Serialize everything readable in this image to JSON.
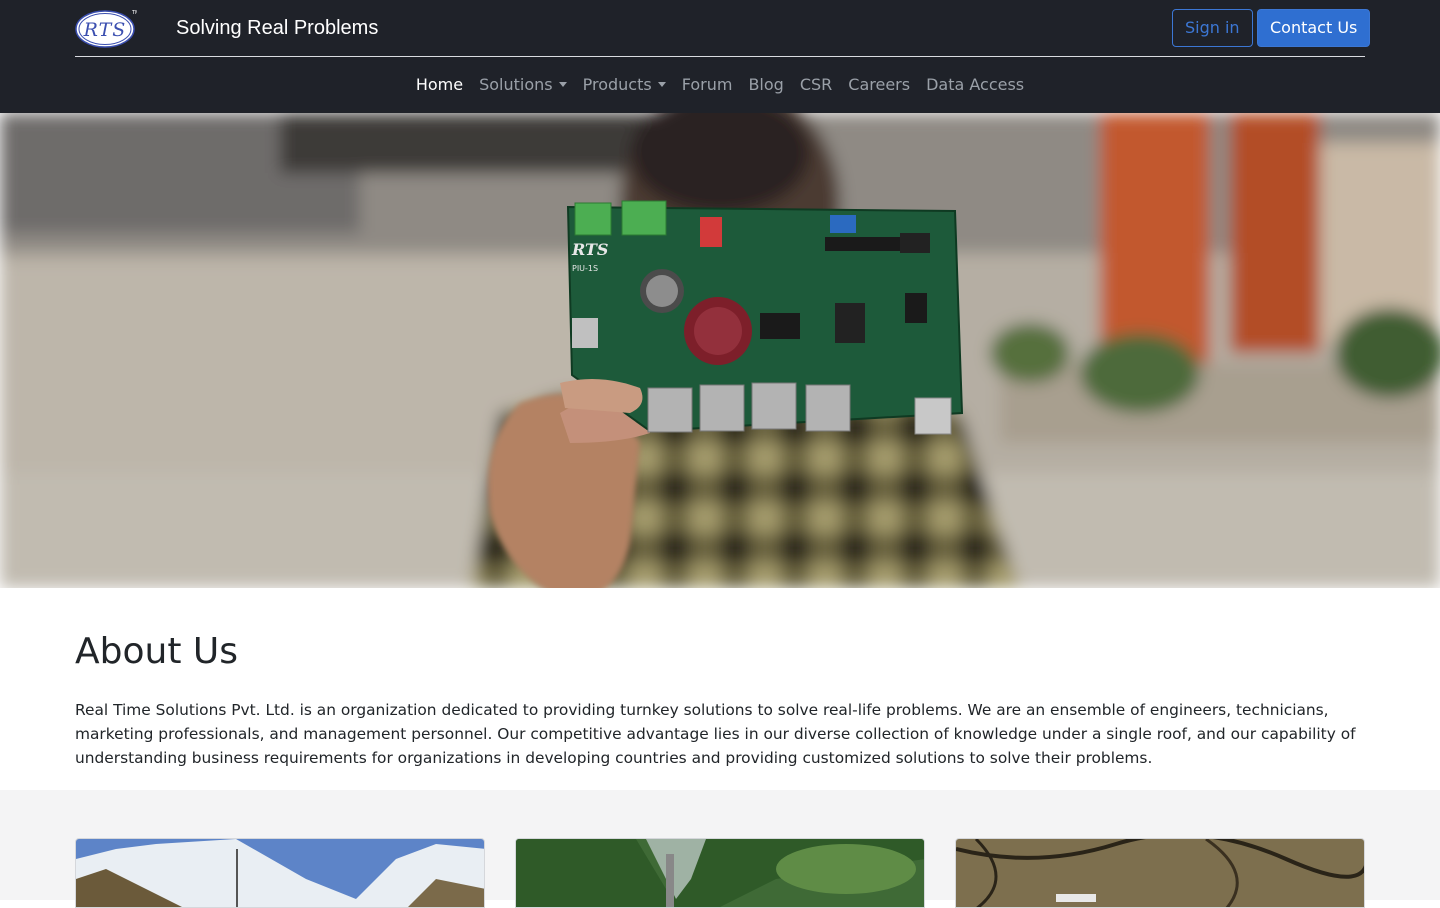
{
  "header": {
    "brand_text": "Solving Real Problems",
    "logo_text": "RTS",
    "logo_tm": "TM",
    "signin_label": "Sign in",
    "contact_label": "Contact Us"
  },
  "nav": {
    "items": [
      {
        "label": "Home",
        "active": true
      },
      {
        "label": "Solutions",
        "dropdown": true
      },
      {
        "label": "Products",
        "dropdown": true
      },
      {
        "label": "Forum"
      },
      {
        "label": "Blog"
      },
      {
        "label": "CSR"
      },
      {
        "label": "Careers"
      },
      {
        "label": "Data Access"
      }
    ]
  },
  "hero": {
    "board_label": "RTS",
    "board_model": "PIU-1S"
  },
  "about": {
    "title": "About Us",
    "text": "Real Time Solutions Pvt. Ltd. is an organization dedicated to providing turnkey solutions to solve real-life problems. We are an ensemble of engineers, technicians, marketing professionals, and management personnel. Our competitive advantage lies in our diverse collection of knowledge under a single roof, and our capability of understanding business requirements for organizations in developing countries and providing customized solutions to solve their problems."
  },
  "colors": {
    "navbar_bg": "#1f2229",
    "accent": "#2f6fd1",
    "section_bg": "#f4f4f5"
  }
}
